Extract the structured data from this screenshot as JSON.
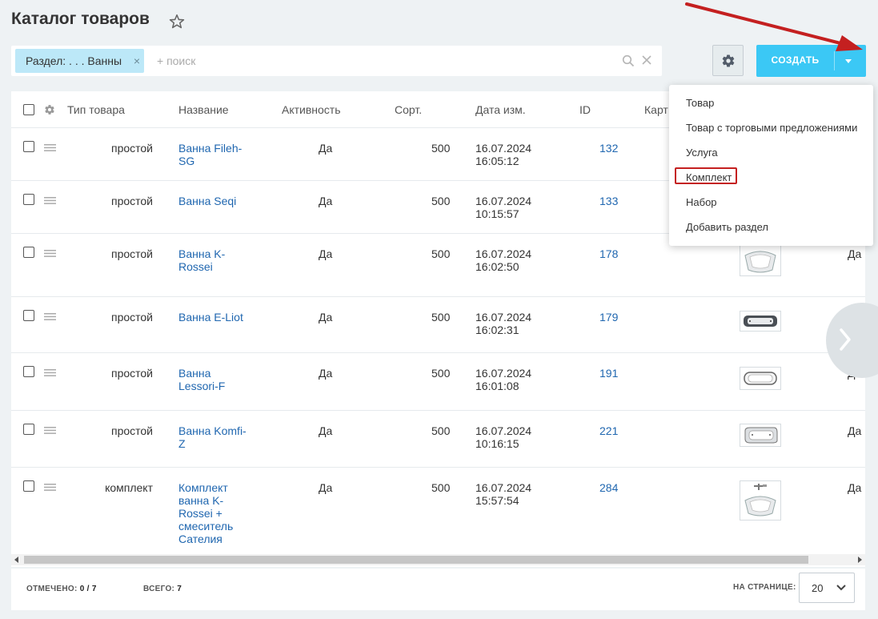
{
  "page_title": "Каталог товаров",
  "search": {
    "filter_tag": "Раздел: . . . Ванны",
    "filter_remove": "×",
    "placeholder": "+ поиск"
  },
  "toolbar": {
    "create_label": "СОЗДАТЬ"
  },
  "grid": {
    "columns": {
      "type": "Тип товара",
      "name": "Название",
      "active": "Активность",
      "sort": "Сорт.",
      "date": "Дата изм.",
      "id": "ID",
      "picture": "Карт"
    },
    "rows": [
      {
        "type": "простой",
        "name": "Ванна Fileh-SG",
        "active": "Да",
        "sort": "500",
        "date": "16.07.2024",
        "time": "16:05:12",
        "id": "132",
        "active2": ""
      },
      {
        "type": "простой",
        "name": "Ванна Seqi",
        "active": "Да",
        "sort": "500",
        "date": "16.07.2024",
        "time": "10:15:57",
        "id": "133",
        "active2": ""
      },
      {
        "type": "простой",
        "name": "Ванна K-Rossei",
        "active": "Да",
        "sort": "500",
        "date": "16.07.2024",
        "time": "16:02:50",
        "id": "178",
        "active2": "Да"
      },
      {
        "type": "простой",
        "name": "Ванна E-Liot",
        "active": "Да",
        "sort": "500",
        "date": "16.07.2024",
        "time": "16:02:31",
        "id": "179",
        "active2": ""
      },
      {
        "type": "простой",
        "name": "Ванна Lessori-F",
        "active": "Да",
        "sort": "500",
        "date": "16.07.2024",
        "time": "16:01:08",
        "id": "191",
        "active2": "Да"
      },
      {
        "type": "простой",
        "name": "Ванна Komfi-Z",
        "active": "Да",
        "sort": "500",
        "date": "16.07.2024",
        "time": "10:16:15",
        "id": "221",
        "active2": "Да"
      },
      {
        "type": "комплект",
        "name": "Комплект ванна K-Rossei + смеситель Сателия",
        "active": "Да",
        "sort": "500",
        "date": "16.07.2024",
        "time": "15:57:54",
        "id": "284",
        "active2": "Да"
      }
    ]
  },
  "footer": {
    "selected_label": "ОТМЕЧЕНО:",
    "selected_value": "0 / 7",
    "total_label": "ВСЕГО:",
    "total_value": "7",
    "per_page_label": "НА СТРАНИЦЕ:",
    "per_page_value": "20"
  },
  "create_menu": [
    "Товар",
    "Товар с торговыми предложениями",
    "Услуга",
    "Комплект",
    "Набор",
    "Добавить раздел"
  ],
  "colors": {
    "accent": "#3bc8f5",
    "link": "#2067b0",
    "filter_tag": "#bce8f8",
    "annotation": "#c42020"
  },
  "icons": [
    "star-icon",
    "search-icon",
    "clear-icon",
    "gear-icon",
    "chevron-down-icon",
    "drag-handle-icon",
    "chevron-right-icon"
  ]
}
